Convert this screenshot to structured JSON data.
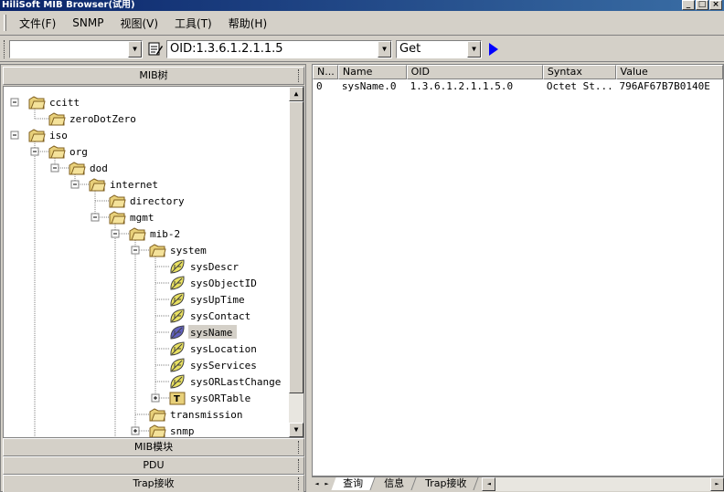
{
  "window": {
    "title": "HiliSoft MIB Browser(试用)",
    "buttons": [
      "_",
      "□",
      "×"
    ]
  },
  "menu": [
    "文件(F)",
    "SNMP",
    "视图(V)",
    "工具(T)",
    "帮助(H)"
  ],
  "toolbar": {
    "agent_value": "",
    "oid_value": "OID:1.3.6.1.2.1.1.5",
    "operation_value": "Get"
  },
  "left_panel": {
    "sections": [
      "MIB树",
      "MIB模块",
      "PDU",
      "Trap接收"
    ],
    "tree": [
      {
        "label": "ccitt",
        "depth": 0,
        "expander": "minus",
        "icon": "folder"
      },
      {
        "label": "zeroDotZero",
        "depth": 1,
        "expander": "none",
        "icon": "folder"
      },
      {
        "label": "iso",
        "depth": 0,
        "expander": "minus",
        "icon": "folder"
      },
      {
        "label": "org",
        "depth": 1,
        "expander": "minus",
        "icon": "folder"
      },
      {
        "label": "dod",
        "depth": 2,
        "expander": "minus",
        "icon": "folder"
      },
      {
        "label": "internet",
        "depth": 3,
        "expander": "minus",
        "icon": "folder"
      },
      {
        "label": "directory",
        "depth": 4,
        "expander": "none",
        "icon": "folder"
      },
      {
        "label": "mgmt",
        "depth": 4,
        "expander": "minus",
        "icon": "folder"
      },
      {
        "label": "mib-2",
        "depth": 5,
        "expander": "minus",
        "icon": "folder"
      },
      {
        "label": "system",
        "depth": 6,
        "expander": "minus",
        "icon": "folder"
      },
      {
        "label": "sysDescr",
        "depth": 7,
        "expander": "none",
        "icon": "leaf"
      },
      {
        "label": "sysObjectID",
        "depth": 7,
        "expander": "none",
        "icon": "leaf"
      },
      {
        "label": "sysUpTime",
        "depth": 7,
        "expander": "none",
        "icon": "leaf"
      },
      {
        "label": "sysContact",
        "depth": 7,
        "expander": "none",
        "icon": "leaf"
      },
      {
        "label": "sysName",
        "depth": 7,
        "expander": "none",
        "icon": "leaf-selected",
        "selected": true
      },
      {
        "label": "sysLocation",
        "depth": 7,
        "expander": "none",
        "icon": "leaf"
      },
      {
        "label": "sysServices",
        "depth": 7,
        "expander": "none",
        "icon": "leaf"
      },
      {
        "label": "sysORLastChange",
        "depth": 7,
        "expander": "none",
        "icon": "leaf"
      },
      {
        "label": "sysORTable",
        "depth": 7,
        "expander": "plus",
        "icon": "table"
      },
      {
        "label": "transmission",
        "depth": 6,
        "expander": "none",
        "icon": "folder"
      },
      {
        "label": "snmp",
        "depth": 6,
        "expander": "plus",
        "icon": "folder"
      }
    ]
  },
  "result_list": {
    "columns": [
      "N...",
      "Name",
      "OID",
      "Syntax",
      "Value"
    ],
    "rows": [
      [
        "0",
        "sysName.0",
        "1.3.6.1.2.1.1.5.0",
        "Octet St...",
        "796AF67B7B0140E"
      ]
    ]
  },
  "bottom_tabs": [
    {
      "label": "查询",
      "active": true
    },
    {
      "label": "信息",
      "active": false
    },
    {
      "label": "Trap接收",
      "active": false
    }
  ],
  "colors": {
    "titlebar": "#0a246a",
    "folder": "#e8d07a",
    "leaf": "#e8e060",
    "leaf_selected": "#6060c0",
    "selection": "#d4d0c8",
    "go_arrow": "#0000ff"
  }
}
